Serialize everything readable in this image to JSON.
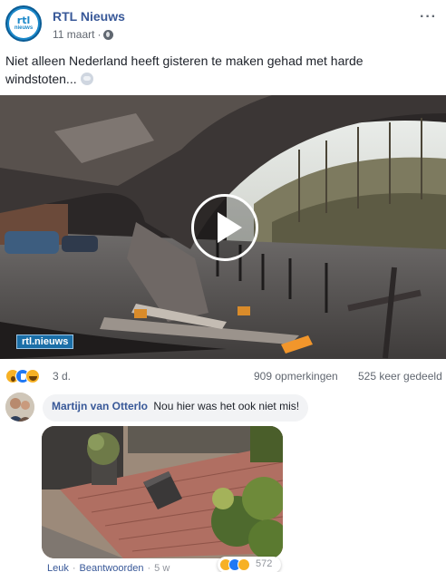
{
  "post": {
    "page_name": "RTL Nieuws",
    "avatar_line1": "rtl",
    "avatar_line2": "nieuws",
    "date": "11 maart",
    "privacy_icon": "globe-icon",
    "text": "Niet alleen Nederland heeft gisteren te maken gehad met harde windstoten...",
    "text_emoji": "wind-face-emoji"
  },
  "video": {
    "watermark": "rtl.nieuws",
    "play_icon": "play-icon"
  },
  "reactions": {
    "types": [
      "wow",
      "like",
      "haha"
    ],
    "time": "3 d.",
    "comments": "909 opmerkingen",
    "shares": "525 keer gedeeld"
  },
  "comment": {
    "author": "Martijn van Otterlo",
    "text": "Nou hier was het ook niet mis!",
    "actions": {
      "like": "Leuk",
      "reply": "Beantwoorden",
      "time": "5 w"
    },
    "reaction_types": [
      "wow",
      "like",
      "sad"
    ],
    "reaction_count": "572"
  },
  "colors": {
    "brand_blue": "#385898",
    "like_blue": "#2078f4",
    "reaction_yellow": "#f7b125",
    "rtl_blue": "#1b88c9"
  }
}
